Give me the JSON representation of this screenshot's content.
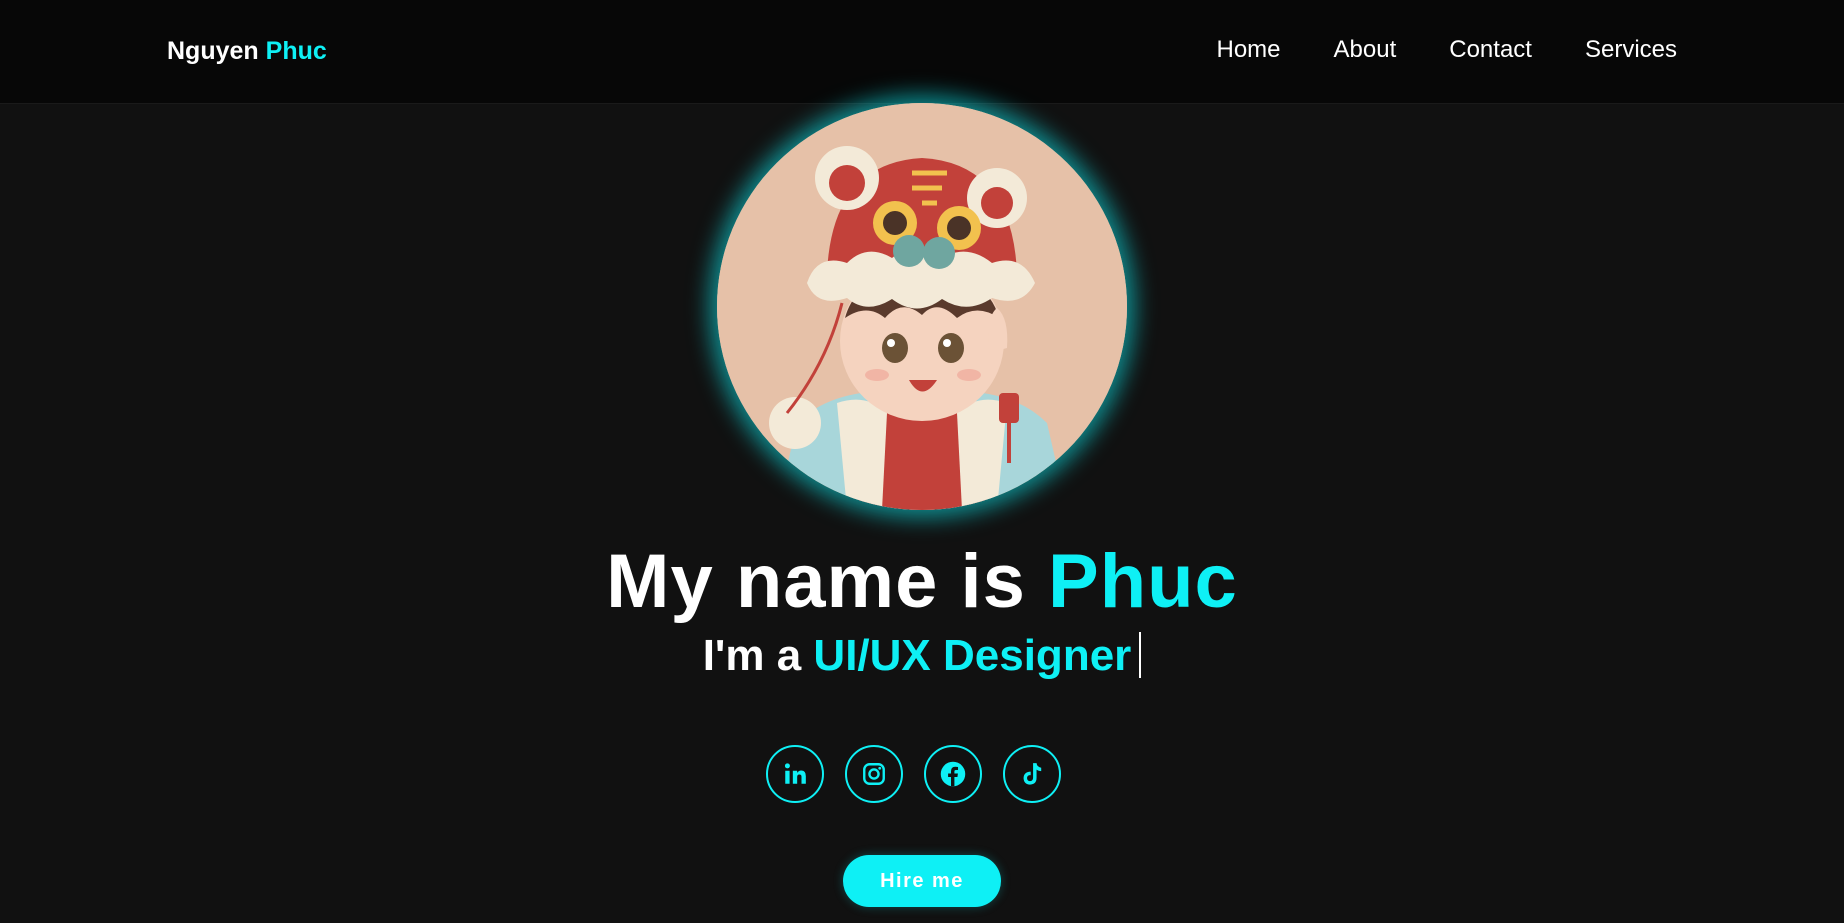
{
  "header": {
    "logo_first": "Nguyen",
    "logo_accent": "Phuc",
    "nav": [
      {
        "label": "Home"
      },
      {
        "label": "About"
      },
      {
        "label": "Contact"
      },
      {
        "label": "Services"
      }
    ]
  },
  "hero": {
    "title_prefix": "My name is ",
    "title_accent": "Phuc",
    "subtitle_prefix": "I'm a ",
    "subtitle_accent": "UI/UX Designer"
  },
  "socials": [
    {
      "icon": "linkedin-icon"
    },
    {
      "icon": "instagram-icon"
    },
    {
      "icon": "facebook-icon"
    },
    {
      "icon": "tiktok-icon"
    }
  ],
  "cta": {
    "hire_label": "Hire me"
  },
  "colors": {
    "accent": "#0ef0f5",
    "background": "#111111",
    "header": "#070707",
    "avatar_bg": "#e6c1a8"
  }
}
